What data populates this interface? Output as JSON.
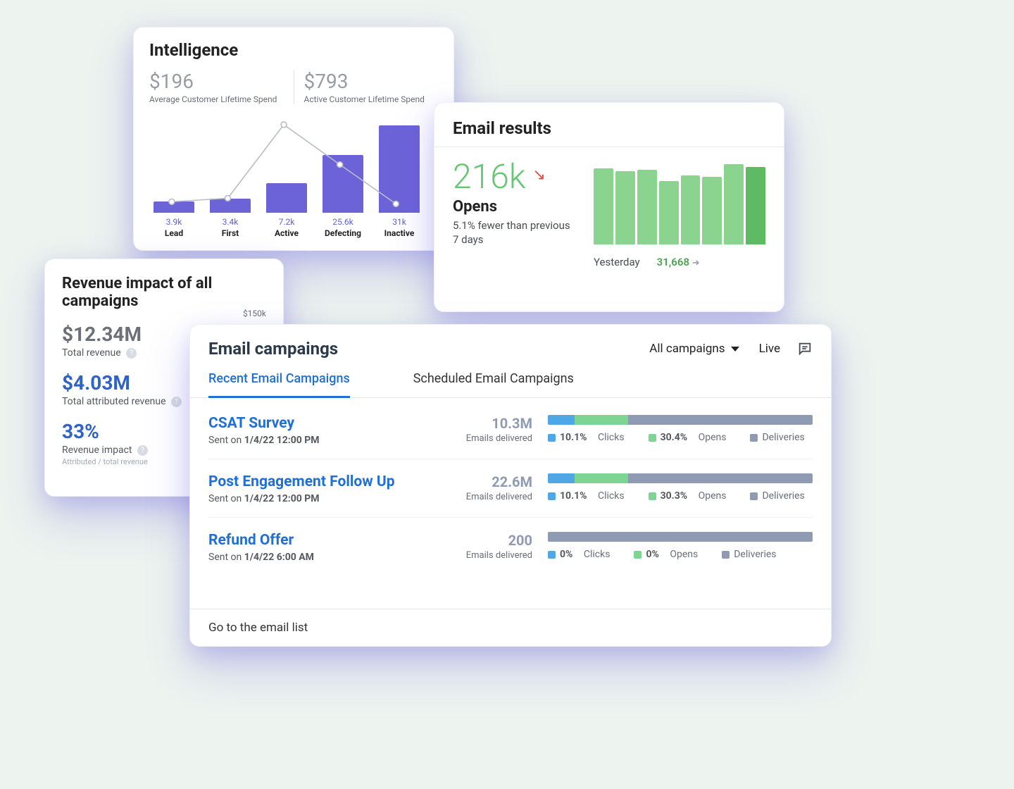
{
  "intelligence": {
    "title": "Intelligence",
    "stats": [
      {
        "value": "$196",
        "label": "Average Customer Lifetime Spend"
      },
      {
        "value": "$793",
        "label": "Active Customer Lifetime Spend"
      }
    ],
    "columns": [
      {
        "count": "3.9k",
        "name": "Lead"
      },
      {
        "count": "3.4k",
        "name": "First"
      },
      {
        "count": "7.2k",
        "name": "Active"
      },
      {
        "count": "25.6k",
        "name": "Defecting"
      },
      {
        "count": "31k",
        "name": "Inactive"
      }
    ]
  },
  "email_results": {
    "title": "Email results",
    "big": "216k",
    "metric": "Opens",
    "change_text": "5.1% fewer than previous 7 days",
    "footer_label": "Yesterday",
    "footer_value": "31,668"
  },
  "revenue": {
    "title": "Revenue impact of all campaigns",
    "tick": "$150k",
    "groups": [
      {
        "value": "$12.34M",
        "label": "Total revenue"
      },
      {
        "value": "$4.03M",
        "label": "Total attributed revenue"
      },
      {
        "value": "33%",
        "label": "Revenue impact",
        "sub": "Attributed / total revenue"
      }
    ]
  },
  "campaigns": {
    "title": "Email campaings",
    "filter": "All campaigns",
    "live": "Live",
    "tabs": {
      "recent": "Recent Email Campaigns",
      "scheduled": "Scheduled Email Campaigns"
    },
    "sent_prefix": "Sent on ",
    "delivered_label": "Emails delivered",
    "legend_clicks": "Clicks",
    "legend_opens": "Opens",
    "legend_deliveries": "Deliveries",
    "rows": [
      {
        "title": "CSAT Survey",
        "sent": "1/4/22 12:00 PM",
        "delivered": "10.3M",
        "clicks": "10.1%",
        "opens": "30.4%"
      },
      {
        "title": "Post Engagement Follow Up",
        "sent": "1/4/22 12:00 PM",
        "delivered": "22.6M",
        "clicks": "10.1%",
        "opens": "30.3%"
      },
      {
        "title": "Refund Offer",
        "sent": "1/4/22 6:00 AM",
        "delivered": "200",
        "clicks": "0%",
        "opens": "0%"
      }
    ],
    "footer": "Go to the email list"
  },
  "chart_data": [
    {
      "type": "bar",
      "id": "intelligence-bars",
      "title": "Intelligence",
      "categories": [
        "Lead",
        "First",
        "Active",
        "Defecting",
        "Inactive"
      ],
      "series": [
        {
          "name": "bar_value_rel",
          "values": [
            16,
            20,
            42,
            82,
            124
          ]
        },
        {
          "name": "count",
          "values": [
            3900,
            3400,
            7200,
            25600,
            31000
          ]
        }
      ],
      "overlay_line": {
        "name": "curve",
        "values": [
          15,
          20,
          125,
          68,
          12
        ]
      }
    },
    {
      "type": "bar",
      "id": "email-opens-7d",
      "title": "Opens last 7 days",
      "categories": [
        "d1",
        "d2",
        "d3",
        "d4",
        "d5",
        "d6",
        "d7",
        "d8"
      ],
      "values": [
        108,
        104,
        106,
        90,
        98,
        96,
        114,
        110
      ],
      "footer": {
        "label": "Yesterday",
        "value": 31668
      },
      "headline": 216000,
      "change_pct": -5.1
    },
    {
      "type": "bar",
      "id": "campaign-breakdown",
      "categories": [
        "CSAT Survey",
        "Post Engagement Follow Up",
        "Refund Offer"
      ],
      "series": [
        {
          "name": "Clicks %",
          "values": [
            10.1,
            10.1,
            0
          ]
        },
        {
          "name": "Opens %",
          "values": [
            30.4,
            30.3,
            0
          ]
        },
        {
          "name": "Delivered",
          "values": [
            10300000,
            22600000,
            200
          ]
        }
      ]
    }
  ]
}
